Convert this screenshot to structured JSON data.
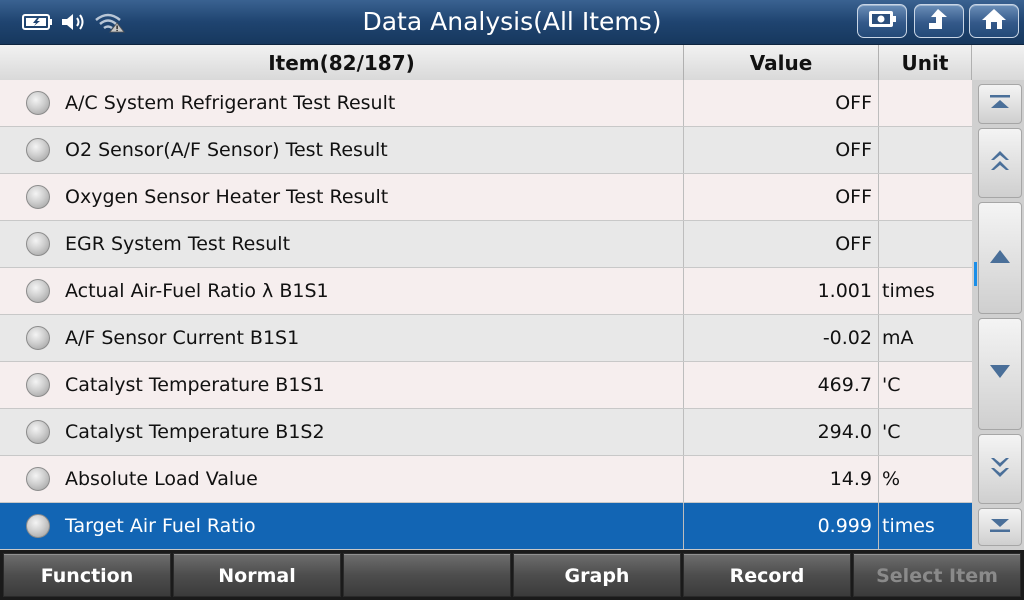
{
  "title": "Data Analysis(All Items)",
  "columns": {
    "item": "Item(82/187)",
    "value": "Value",
    "unit": "Unit"
  },
  "rows": [
    {
      "label": "A/C System Refrigerant Test Result",
      "value": "OFF",
      "unit": ""
    },
    {
      "label": "O2 Sensor(A/F Sensor) Test Result",
      "value": "OFF",
      "unit": ""
    },
    {
      "label": "Oxygen Sensor Heater Test Result",
      "value": "OFF",
      "unit": ""
    },
    {
      "label": "EGR System Test Result",
      "value": "OFF",
      "unit": ""
    },
    {
      "label": "Actual Air-Fuel Ratio λ B1S1",
      "value": "1.001",
      "unit": "times"
    },
    {
      "label": "A/F Sensor Current B1S1",
      "value": "-0.02",
      "unit": "mA"
    },
    {
      "label": "Catalyst Temperature B1S1",
      "value": "469.7",
      "unit": "'C"
    },
    {
      "label": "Catalyst Temperature B1S2",
      "value": "294.0",
      "unit": "'C"
    },
    {
      "label": "Absolute Load Value",
      "value": "14.9",
      "unit": "%"
    },
    {
      "label": "Target Air Fuel Ratio",
      "value": "0.999",
      "unit": "times"
    }
  ],
  "selected_row": 9,
  "bottom": {
    "function": "Function",
    "normal": "Normal",
    "empty": "",
    "graph": "Graph",
    "record": "Record",
    "select_item": "Select Item"
  },
  "icons": {
    "battery": "battery-icon",
    "volume": "volume-icon",
    "wifi": "wifi-warning-icon",
    "screenshot": "screenshot-icon",
    "back": "back-icon",
    "home": "home-icon"
  },
  "colors": {
    "titlebar": "#1f4470",
    "selected": "#1265b4",
    "scroll_indicator": "#1b8ee8"
  }
}
